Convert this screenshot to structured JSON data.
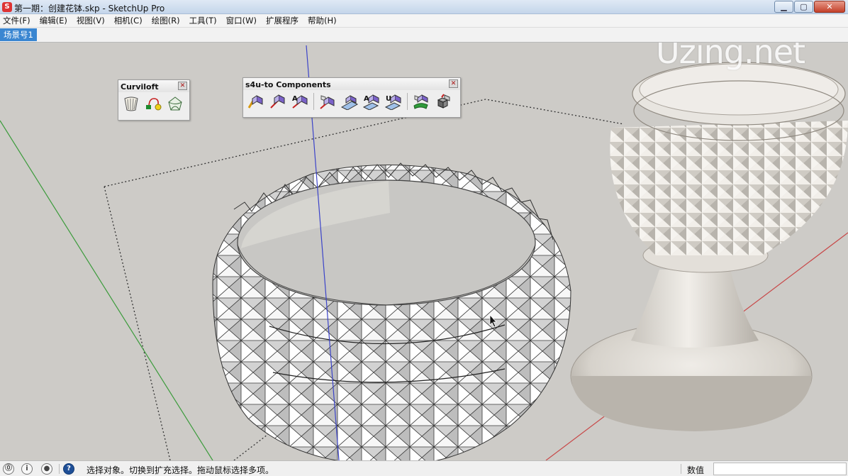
{
  "window": {
    "title": "第一期：创建花钵.skp - SketchUp Pro",
    "app_icon": "sketchup-icon",
    "controls": {
      "minimize": "▁",
      "maximize": "▢",
      "close": "✕"
    }
  },
  "menu": {
    "items": [
      "文件(F)",
      "编辑(E)",
      "视图(V)",
      "相机(C)",
      "绘图(R)",
      "工具(T)",
      "窗口(W)",
      "扩展程序",
      "帮助(H)"
    ]
  },
  "scenes": {
    "tabs": [
      "场景号1"
    ]
  },
  "watermark": "Uzing.net",
  "toolbars": {
    "curviloft": {
      "title": "Curviloft",
      "close": "✕",
      "tools": [
        "curviloft-loft-by-spline-icon",
        "curviloft-loft-along-path-icon",
        "curviloft-skinning-icon"
      ]
    },
    "s4u": {
      "title": "s4u-to Components",
      "close": "✕",
      "tools": [
        "s4u-pencil-component-icon",
        "s4u-component-line-icon",
        "s4u-component-a-icon",
        "s4u-component-pair-icon",
        "s4u-component-slope-icon",
        "s4u-component-a2-icon",
        "s4u-component-u-icon",
        "s4u-components-stack-icon",
        "s4u-component-cubes-icon"
      ]
    }
  },
  "colors": {
    "viewport": "#cdcbc7",
    "axis_blue": "#3b43c9",
    "axis_green": "#3b9b3b",
    "axis_red": "#c84848",
    "scene_tab": "#3a86d1"
  },
  "status": {
    "icons": [
      "geo-location-icon",
      "credits-icon",
      "user-account-icon",
      "help-icon"
    ],
    "message": "选择对象。切换到扩充选择。拖动鼠标选择多项。",
    "measurements_label": "数值",
    "measurements_value": ""
  }
}
